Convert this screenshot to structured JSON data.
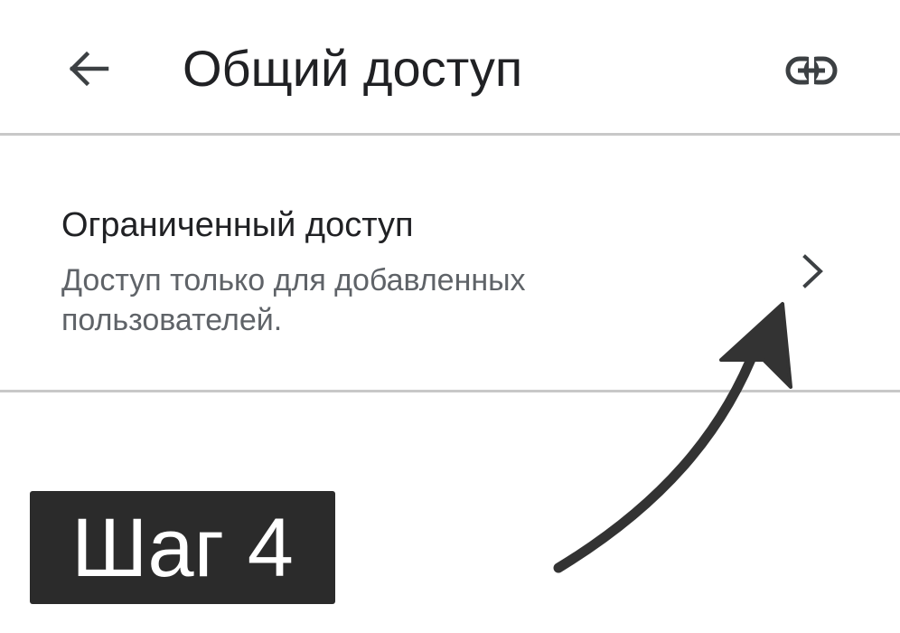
{
  "header": {
    "back_icon": "arrow-left-icon",
    "title": "Общий доступ",
    "link_icon": "link-icon"
  },
  "access": {
    "title": "Ограниченный доступ",
    "description": "Доступ только для добавленных пользователей.",
    "chevron_icon": "chevron-right-icon"
  },
  "annotation": {
    "step_label": "Шаг 4",
    "badge_color": "#2b2b2b",
    "arrow_color": "#333333"
  },
  "colors": {
    "text_primary": "#202124",
    "text_secondary": "#5f6368",
    "divider": "#c8c8c8"
  }
}
